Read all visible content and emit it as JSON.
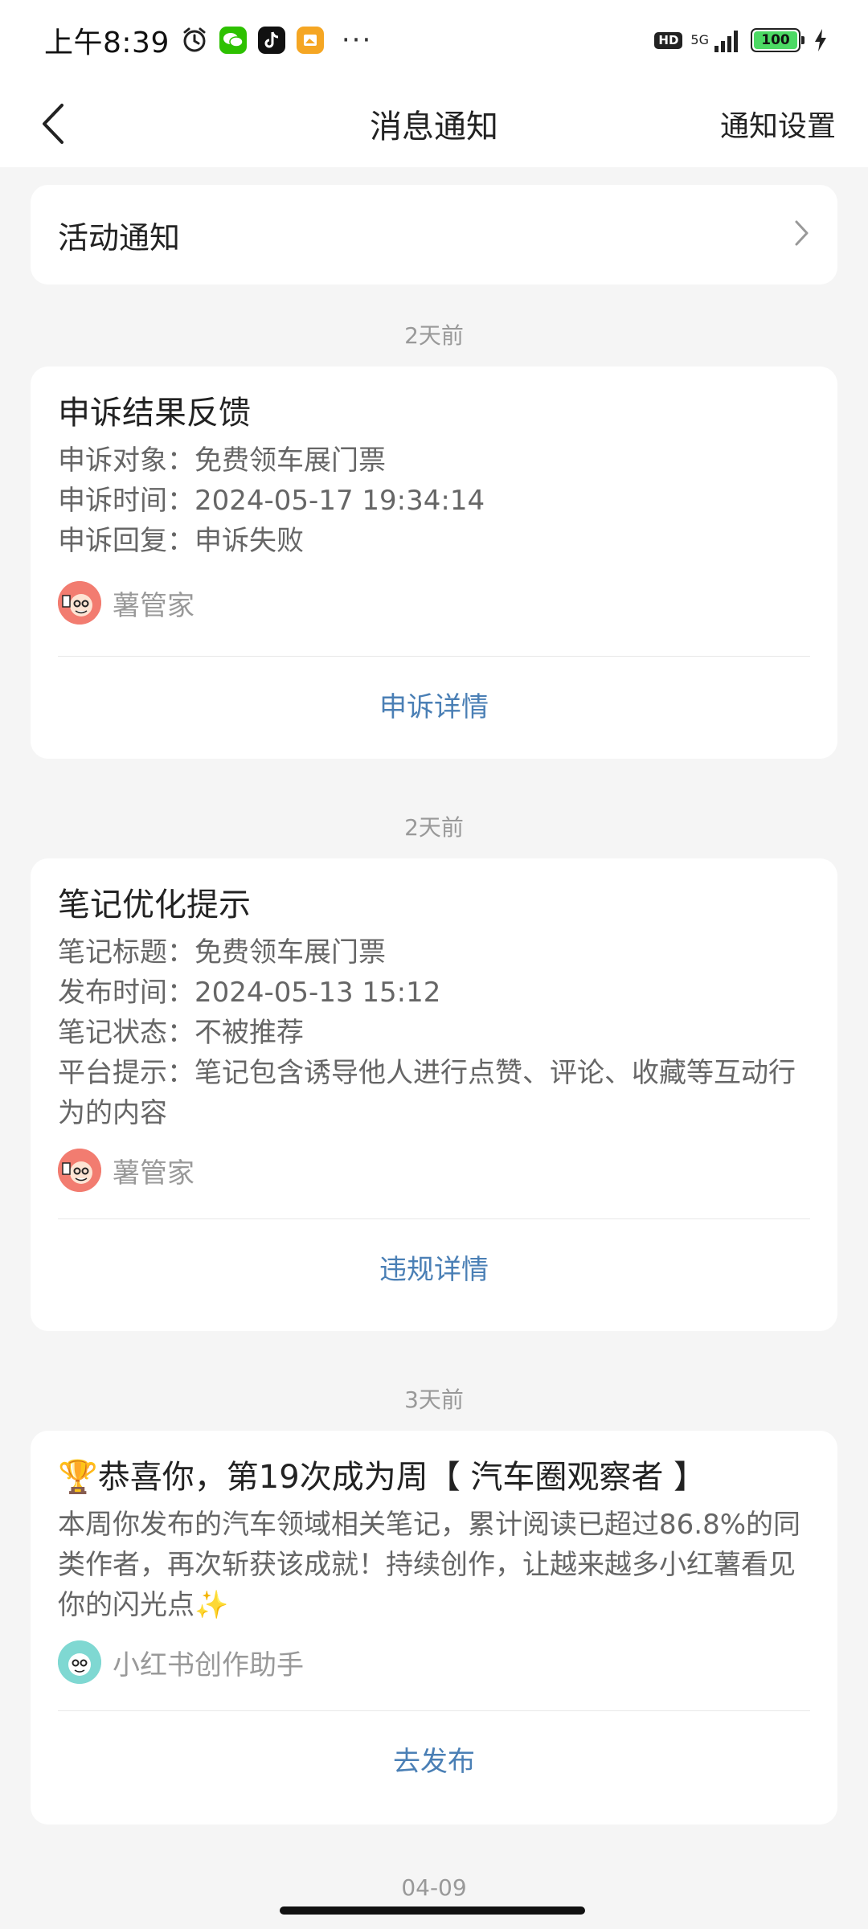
{
  "status_bar": {
    "time": "上午8:39",
    "icons": [
      "alarm-icon",
      "wechat-icon",
      "tiktok-icon",
      "gallery-icon"
    ],
    "more": "···",
    "hd": "HD",
    "network": "5G",
    "battery": "100"
  },
  "nav": {
    "title": "消息通知",
    "right_action": "通知设置"
  },
  "activity": {
    "label": "活动通知"
  },
  "notifications": [
    {
      "time": "2天前",
      "title": "申诉结果反馈",
      "lines": [
        "申诉对象：免费领车展门票",
        "申诉时间：2024-05-17 19:34:14",
        "申诉回复：申诉失败"
      ],
      "sender": "薯管家",
      "action": "申诉详情"
    },
    {
      "time": "2天前",
      "title": "笔记优化提示",
      "lines": [
        "笔记标题：免费领车展门票",
        "发布时间：2024-05-13 15:12",
        "笔记状态：不被推荐",
        "平台提示：笔记包含诱导他人进行点赞、评论、收藏等互动行为的内容"
      ],
      "sender": "薯管家",
      "action": "违规详情"
    },
    {
      "time": "3天前",
      "title": "🏆恭喜你，第19次成为周【 汽车圈观察者 】",
      "body": "本周你发布的汽车领域相关笔记，累计阅读已超过86.8%的同类作者，再次斩获该成就！持续创作，让越来越多小红薯看见你的闪光点✨",
      "sender": "小红书创作助手",
      "action": "去发布"
    }
  ],
  "next_time": "04-09",
  "colors": {
    "link": "#4a7fb5",
    "background": "#f5f5f5",
    "secondary_text": "#666666"
  }
}
